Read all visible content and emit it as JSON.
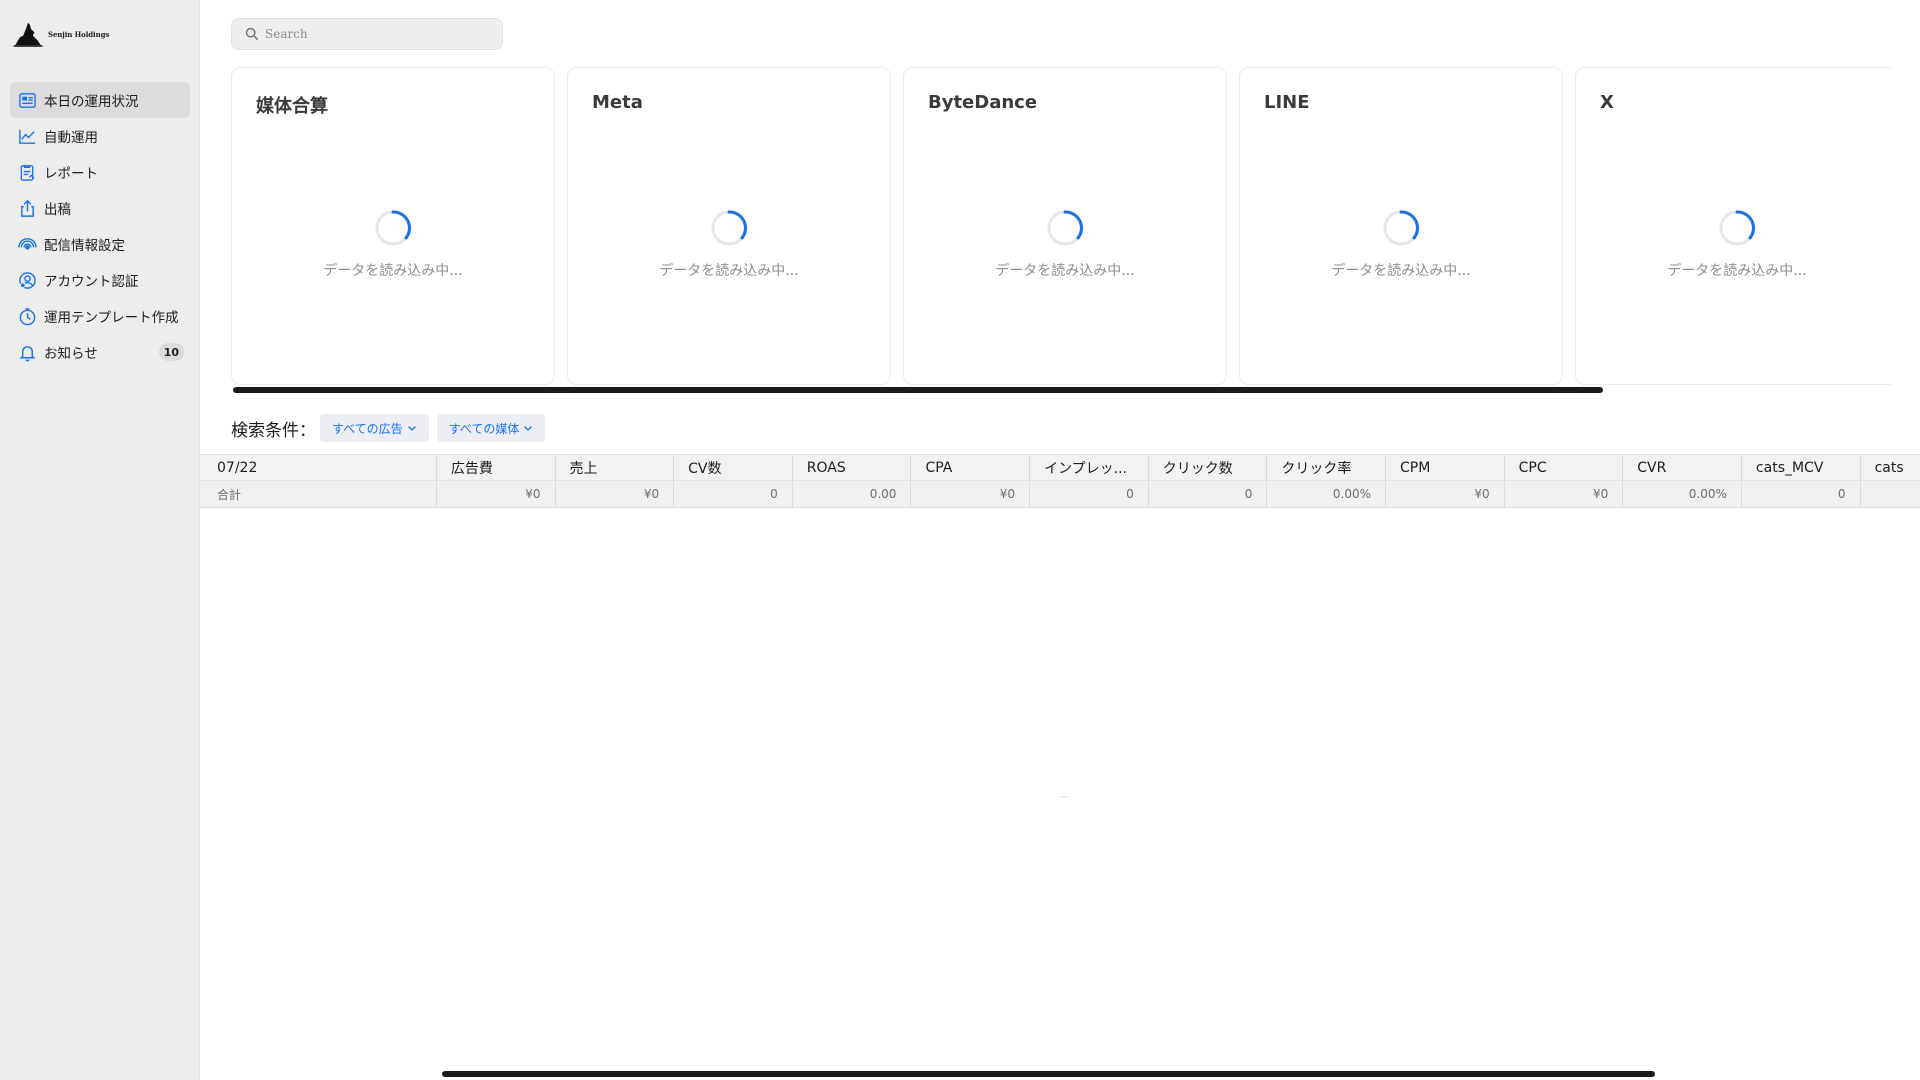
{
  "sidebar": {
    "logo_text": "Senjin Holdings",
    "items": [
      {
        "label": "本日の運用状況",
        "icon": "dashboard-icon",
        "active": true
      },
      {
        "label": "自動運用",
        "icon": "chart-line-icon"
      },
      {
        "label": "レポート",
        "icon": "report-icon"
      },
      {
        "label": "出稿",
        "icon": "upload-icon"
      },
      {
        "label": "配信情報設定",
        "icon": "broadcast-icon"
      },
      {
        "label": "アカウント認証",
        "icon": "account-auth-icon"
      },
      {
        "label": "運用テンプレート作成",
        "icon": "timer-icon"
      },
      {
        "label": "お知らせ",
        "icon": "bell-icon",
        "badge": "10"
      }
    ]
  },
  "search": {
    "placeholder": "Search"
  },
  "cards": [
    {
      "title": "媒体合算",
      "loading": "データを読み込み中..."
    },
    {
      "title": "Meta",
      "loading": "データを読み込み中..."
    },
    {
      "title": "ByteDance",
      "loading": "データを読み込み中..."
    },
    {
      "title": "LINE",
      "loading": "データを読み込み中..."
    },
    {
      "title": "X",
      "loading": "データを読み込み中..."
    }
  ],
  "filters": {
    "label": "検索条件：",
    "ads": "すべての広告",
    "media": "すべての媒体"
  },
  "table": {
    "headers": [
      "07/22",
      "広告費",
      "売上",
      "CV数",
      "ROAS",
      "CPA",
      "インプレッ...",
      "クリック数",
      "クリック率",
      "CPM",
      "CPC",
      "CVR",
      "cats_MCV",
      "cats"
    ],
    "total": [
      "合計",
      "¥0",
      "¥0",
      "0",
      "0.00",
      "¥0",
      "0",
      "0",
      "0.00%",
      "¥0",
      "¥0",
      "0.00%",
      "0",
      ""
    ]
  },
  "empty_mark": "—",
  "colors": {
    "accent": "#1a73e8",
    "sidebar_bg": "#ececed",
    "active_bg": "#dcdcde"
  }
}
